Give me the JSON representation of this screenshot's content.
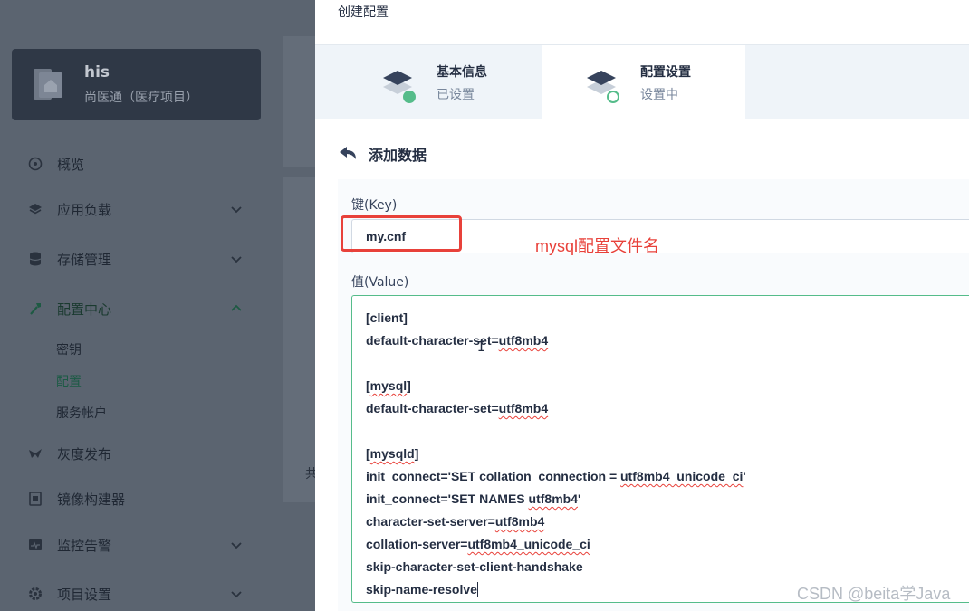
{
  "sidebar": {
    "project": {
      "name": "his",
      "description": "尚医通（医疗项目）"
    },
    "nav": [
      {
        "label": "概览",
        "icon": "dashboard-icon"
      },
      {
        "label": "应用负载",
        "icon": "layers-icon"
      },
      {
        "label": "存储管理",
        "icon": "database-icon"
      },
      {
        "label": "配置中心",
        "icon": "wrench-icon",
        "active": true
      },
      {
        "label": "灰度发布",
        "icon": "bird-icon"
      },
      {
        "label": "镜像构建器",
        "icon": "image-builder-icon"
      },
      {
        "label": "监控告警",
        "icon": "monitor-icon"
      },
      {
        "label": "项目设置",
        "icon": "settings-icon"
      }
    ],
    "sub_items": [
      "密钥",
      "配置",
      "服务帐户"
    ],
    "fragment_text": "共"
  },
  "panel": {
    "title": "创建配置",
    "steps": [
      {
        "title": "基本信息",
        "status": "已设置",
        "state": "done"
      },
      {
        "title": "配置设置",
        "status": "设置中",
        "state": "active"
      }
    ],
    "section_title": "添加数据",
    "key_label": "键(Key)",
    "key_value": "my.cnf",
    "annotation": "mysql配置文件名",
    "value_label": "值(Value)",
    "value_lines": [
      "[client]",
      "default-character-set=utf8mb4",
      "",
      "[mysql]",
      "default-character-set=utf8mb4",
      "",
      "[mysqld]",
      "init_connect='SET collation_connection = utf8mb4_unicode_ci'",
      "init_connect='SET NAMES utf8mb4'",
      "character-set-server=utf8mb4",
      "collation-server=utf8mb4_unicode_ci",
      "skip-character-set-client-handshake",
      "skip-name-resolve"
    ]
  },
  "watermark": "CSDN @beita学Java",
  "colors": {
    "accent_green": "#55bc8a",
    "annotation_red": "#e8413a",
    "dark_text": "#242e42"
  }
}
